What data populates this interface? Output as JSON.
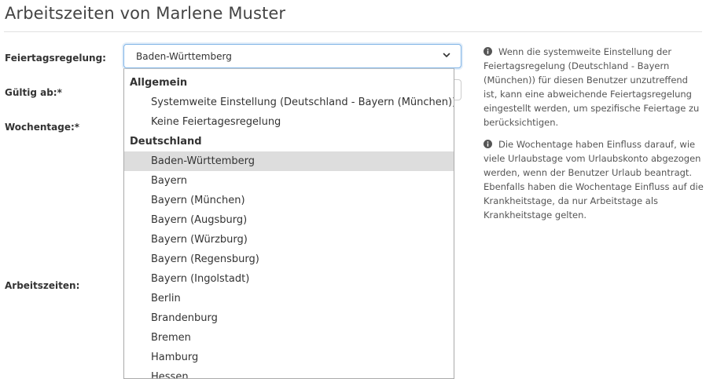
{
  "page": {
    "title": "Arbeitszeiten von Marlene Muster"
  },
  "form": {
    "holiday_label": "Feiertagsregelung:",
    "valid_from_label": "Gültig ab:*",
    "weekdays_label": "Wochentage:*",
    "working_times_label": "Arbeitszeiten:"
  },
  "holiday_select": {
    "selected_value": "Baden-Württemberg",
    "groups": [
      {
        "label": "Allgemein",
        "options": [
          "Systemweite Einstellung (Deutschland - Bayern (München))",
          "Keine Feiertagesregelung"
        ]
      },
      {
        "label": "Deutschland",
        "options": [
          "Baden-Württemberg",
          "Bayern",
          "Bayern (München)",
          "Bayern (Augsburg)",
          "Bayern (Würzburg)",
          "Bayern (Regensburg)",
          "Bayern (Ingolstadt)",
          "Berlin",
          "Brandenburg",
          "Bremen",
          "Hamburg",
          "Hessen"
        ]
      }
    ],
    "highlighted_option": "Baden-Württemberg"
  },
  "help": {
    "holiday_text": "Wenn die systemweite Einstellung der Feiertagsregelung (Deutschland - Bayern (München)) für diesen Benutzer unzutreffend ist, kann eine abweichende Feiertagsregelung eingestellt werden, um spezifische Feiertage zu berücksichtigen.",
    "weekdays_text": "Die Wochentage haben Einfluss darauf, wie viele Urlaubstage vom Urlaubskonto abgezogen werden, wenn der Benutzer Urlaub beantragt. Ebenfalls haben die Wochentage Einfluss auf die Krankheitstage, da nur Arbeitstage als Krankheitstage gelten."
  },
  "icons": {
    "info": "info-circle-icon",
    "chevron": "chevron-down-icon"
  },
  "colors": {
    "focus_border": "#7fb3e6",
    "highlight": "#dddddd",
    "text": "#333333",
    "muted_text": "#555555"
  }
}
